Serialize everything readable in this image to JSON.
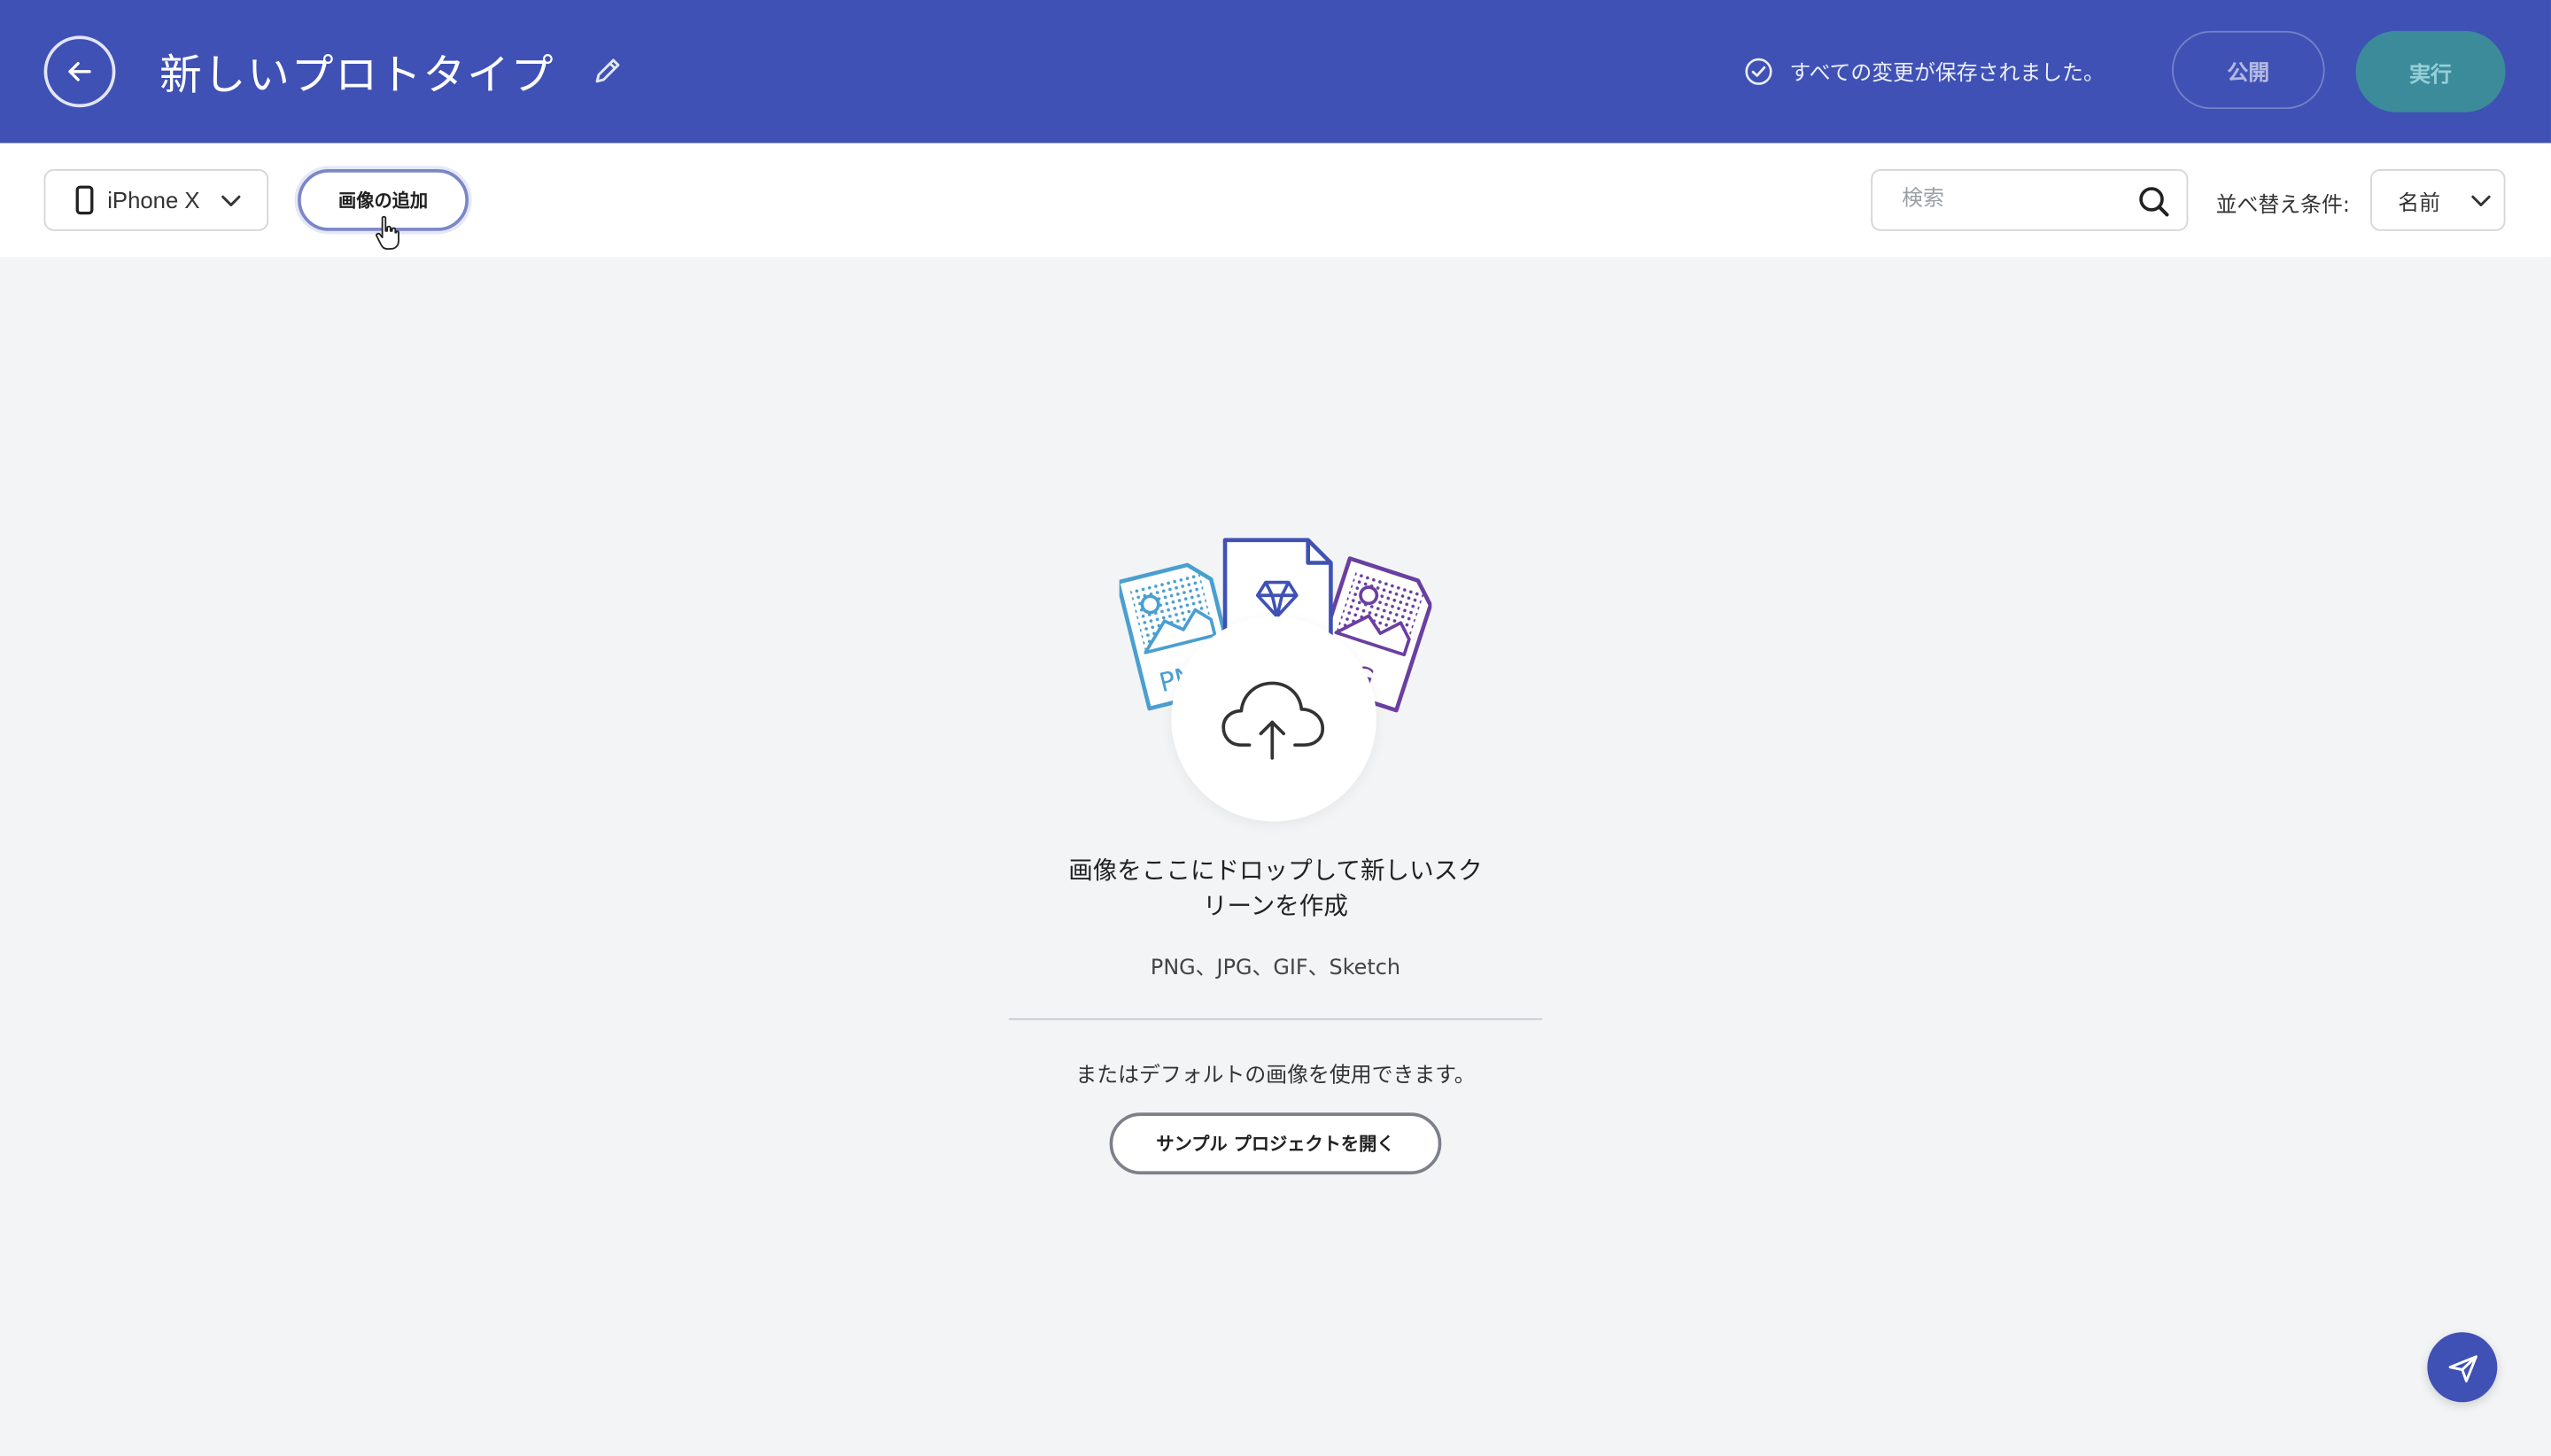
{
  "header": {
    "title": "新しいプロトタイプ",
    "save_status": "すべての変更が保存されました。",
    "publish_label": "公開",
    "run_label": "実行",
    "accent_color": "#3f51b5",
    "run_color": "#3b8b9b"
  },
  "toolbar": {
    "device_label": "iPhone X",
    "add_image_label": "画像の追加",
    "search_placeholder": "検索",
    "sort_label": "並べ替え条件:",
    "sort_value": "名前"
  },
  "main": {
    "drop_text_line1": "画像をここにドロップして新しいスク",
    "drop_text_line2": "リーンを作成",
    "formats": "PNG、JPG、GIF、Sketch",
    "default_text": "またはデフォルトの画像を使用できます。",
    "sample_button_label": "サンプル プロジェクトを開く"
  },
  "illustration": {
    "left_file_label": "PNG",
    "right_file_label": "JPG"
  },
  "icons": [
    "back-arrow-icon",
    "pencil-icon",
    "check-circle-icon",
    "phone-icon",
    "chevron-down-icon",
    "pointer-cursor-icon",
    "search-icon",
    "cloud-upload-icon",
    "send-icon"
  ]
}
